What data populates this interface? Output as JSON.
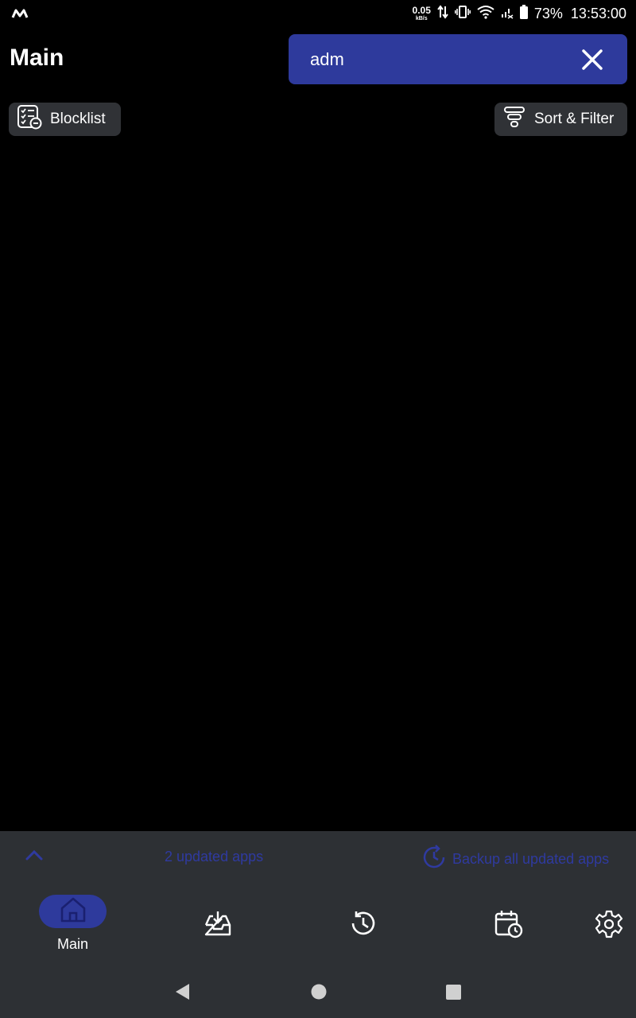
{
  "status_bar": {
    "net_speed_value": "0.05",
    "net_speed_unit": "kB/s",
    "battery_percent": "73%",
    "time": "13:53:00"
  },
  "header": {
    "title": "Main",
    "search": {
      "value": "adm",
      "placeholder": ""
    }
  },
  "chips": {
    "blocklist_label": "Blocklist",
    "sort_filter_label": "Sort & Filter"
  },
  "updated_bar": {
    "count_text": "2 updated apps",
    "backup_label": "Backup all updated apps"
  },
  "bottom_nav": {
    "items": [
      {
        "label": "Main",
        "icon": "home-icon",
        "active": true
      },
      {
        "label": "",
        "icon": "inbox-download-icon",
        "active": false
      },
      {
        "label": "",
        "icon": "history-icon",
        "active": false
      },
      {
        "label": "",
        "icon": "calendar-clock-icon",
        "active": false
      },
      {
        "label": "",
        "icon": "gear-icon",
        "active": false
      }
    ]
  },
  "colors": {
    "accent": "#2e3a9c",
    "accent_text": "#2f3aa0",
    "background": "#000000",
    "panel": "#2d3034",
    "chip": "#303236"
  }
}
